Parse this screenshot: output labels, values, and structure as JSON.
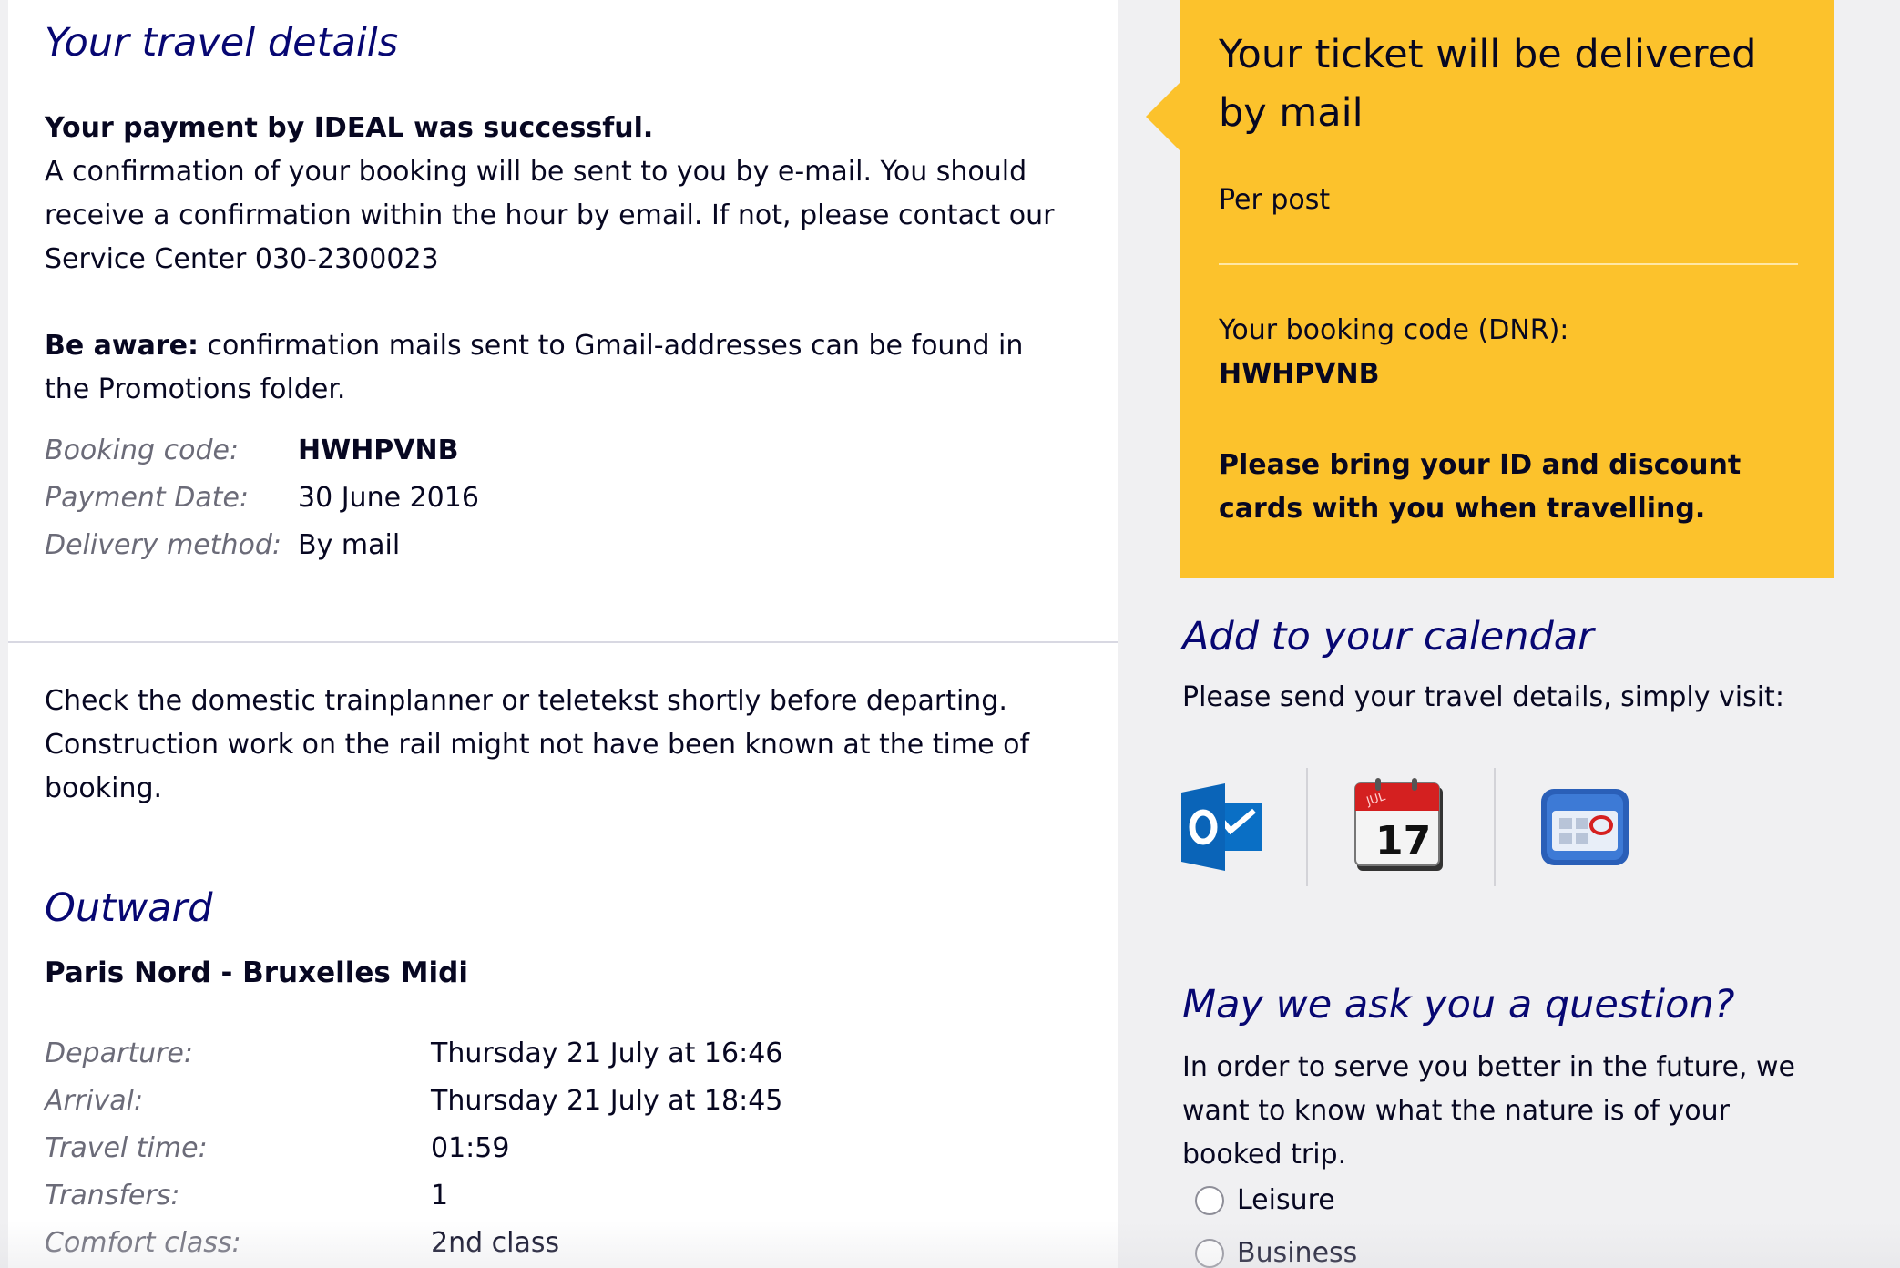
{
  "travel": {
    "title": "Your travel details",
    "payment_success": "Your payment by IDEAL was successful.",
    "confirmation_text": "A confirmation of your booking will be sent to you by e-mail. You should receive a confirmation within the hour by email. If not, please contact our Service Center 030-2300023",
    "aware_label": "Be aware:",
    "aware_text": "confirmation mails sent to Gmail-addresses can be found in the Promotions folder.",
    "booking": [
      {
        "label": "Booking code:",
        "value": "HWHPVNB"
      },
      {
        "label": "Payment Date:",
        "value": "30 June 2016"
      },
      {
        "label": "Delivery method:",
        "value": "By mail"
      }
    ],
    "notice": "Check the domestic trainplanner or teletekst shortly before departing. Construction work on the rail might not have been known at the time of booking."
  },
  "outward": {
    "title": "Outward",
    "route": "Paris Nord - Bruxelles Midi",
    "details": [
      {
        "label": "Departure:",
        "value": "Thursday 21 July at 16:46"
      },
      {
        "label": "Arrival:",
        "value": "Thursday 21 July at 18:45"
      },
      {
        "label": "Travel time:",
        "value": "01:59"
      },
      {
        "label": "Transfers:",
        "value": "1"
      },
      {
        "label": "Comfort class:",
        "value": "2nd class"
      }
    ]
  },
  "ticket": {
    "title": "Your ticket will be delivered by mail",
    "method": "Per post",
    "dnr_label": "Your booking code (DNR):",
    "dnr_code": "HWHPVNB",
    "bring_note": "Please bring your ID and discount cards with you when travelling.",
    "box_color": "#fcc22c"
  },
  "calendar": {
    "title": "Add to your calendar",
    "subtitle": "Please send your travel details, simply visit:",
    "icons": [
      {
        "name": "outlook-icon"
      },
      {
        "name": "ical-icon",
        "day": "17",
        "month": "JUL"
      },
      {
        "name": "google-calendar-icon"
      }
    ]
  },
  "question": {
    "title": "May we ask you a question?",
    "text": "In order to serve you better in the future, we want to know what the nature is of your booked trip.",
    "options": [
      "Leisure",
      "Business"
    ]
  },
  "colors": {
    "heading_blue": "#070772",
    "text": "#070721",
    "label_gray": "#6b6b78"
  }
}
